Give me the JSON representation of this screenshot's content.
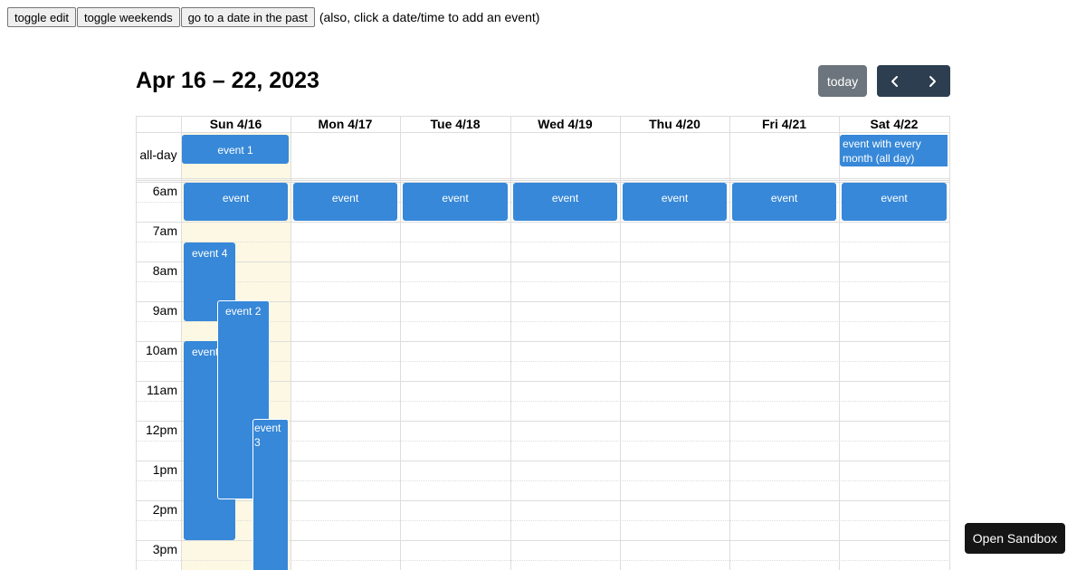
{
  "toolbar": {
    "toggle_edit": "toggle edit",
    "toggle_weekends": "toggle weekends",
    "go_past": "go to a date in the past",
    "hint": "(also, click a date/time to add an event)"
  },
  "calendar": {
    "title": "Apr 16 – 22, 2023",
    "today_label": "today",
    "prev_icon": "chevron-left-icon",
    "next_icon": "chevron-right-icon",
    "days": [
      "Sun 4/16",
      "Mon 4/17",
      "Tue 4/18",
      "Wed 4/19",
      "Thu 4/20",
      "Fri 4/21",
      "Sat 4/22"
    ],
    "allday_label": "all-day",
    "times": [
      "6am",
      "7am",
      "8am",
      "9am",
      "10am",
      "11am",
      "12pm",
      "1pm",
      "2pm",
      "3pm"
    ],
    "allday_events": [
      {
        "title": "event 1",
        "day": "Sun 4/16"
      },
      {
        "title": "event with every month (all day)",
        "day": "Sat 4/22"
      }
    ],
    "timed_events": [
      {
        "title": "event",
        "day": "Sun 4/16"
      },
      {
        "title": "event",
        "day": "Mon 4/17"
      },
      {
        "title": "event",
        "day": "Tue 4/18"
      },
      {
        "title": "event",
        "day": "Wed 4/19"
      },
      {
        "title": "event",
        "day": "Thu 4/20"
      },
      {
        "title": "event",
        "day": "Fri 4/21"
      },
      {
        "title": "event",
        "day": "Sat 4/22"
      },
      {
        "title": "event 4",
        "day": "Sun 4/16"
      },
      {
        "title": "event",
        "day": "Sun 4/16"
      },
      {
        "title": "event 2",
        "day": "Sun 4/16"
      },
      {
        "title": "event 3",
        "day": "Sun 4/16"
      }
    ]
  },
  "colors": {
    "event": "#3788d8",
    "today_highlight": "#fcf8e3",
    "nav": "#2c3e50",
    "today_button": "#6c757d"
  },
  "sandbox_label": "Open Sandbox"
}
